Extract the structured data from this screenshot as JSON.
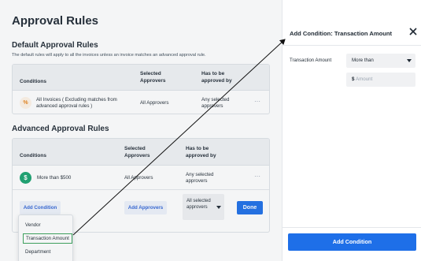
{
  "page": {
    "title": "Approval Rules"
  },
  "default_rules": {
    "title": "Default Approval Rules",
    "description": "The default rules will apply to all the invoices unless an invoice matches an advanced approval rule.",
    "columns": [
      "Conditions",
      "Selected Approvers",
      "Has to be approved by"
    ],
    "rows": [
      {
        "icon": "percent-icon",
        "condition": "All Invoices ( Excluding matches from advanced approval rules )",
        "approvers": "All Approvers",
        "approved_by": "Any selected approvers",
        "menu": "···"
      }
    ]
  },
  "advanced_rules": {
    "title": "Advanced Approval Rules",
    "columns": [
      "Conditions",
      "Selected Approvers",
      "Has to be approved by"
    ],
    "rows": [
      {
        "icon": "dollar-icon",
        "condition": "More than $500",
        "approvers": "All Approvers",
        "approved_by": "Any selected approvers",
        "menu": "···"
      }
    ],
    "add_condition_label": "Add Condition",
    "add_approvers_label": "Add Approvers",
    "approved_by_select": "All selected approvers",
    "done_label": "Done"
  },
  "condition_dropdown": {
    "items": [
      "Vendor",
      "Transaction Amount",
      "Department"
    ],
    "selected": "Transaction Amount"
  },
  "side_panel": {
    "title": "Add Condition: Transaction Amount",
    "close_icon": "close-icon",
    "field_label": "Transaction Amount",
    "operator_value": "More than",
    "amount_prefix": "$",
    "amount_placeholder": "Amount",
    "submit_label": "Add Condition"
  },
  "colors": {
    "primary": "#1e6fe8",
    "success": "#1aa36f",
    "warning": "#e8841a",
    "selected_outline": "#3aa35a"
  }
}
